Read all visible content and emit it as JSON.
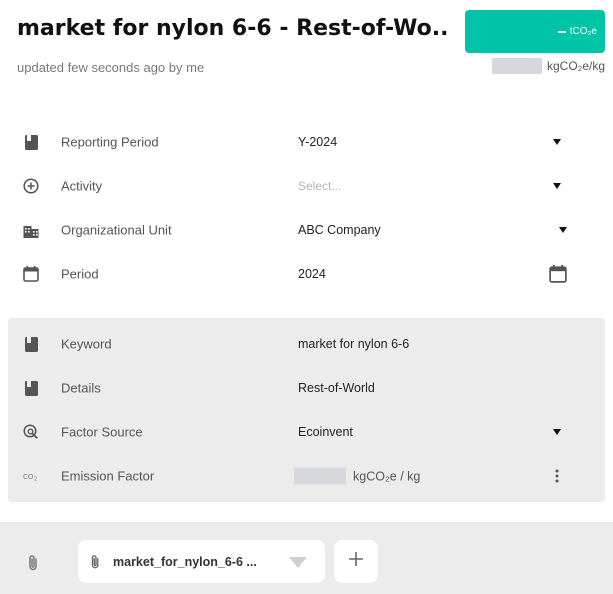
{
  "header": {
    "title": "market for nylon 6-6 - Rest-of-Wo...",
    "subtitle": "updated few seconds ago by me",
    "emission_unit": "tCO₂e",
    "intensity_unit": "kgCO₂e/kg",
    "accent_color": "#00c4a7"
  },
  "form": {
    "reporting_period": {
      "label": "Reporting Period",
      "value": "Y-2024",
      "icon": "bookmark-icon"
    },
    "activity": {
      "label": "Activity",
      "placeholder": "Select...",
      "icon": "add-circle-icon"
    },
    "organizational_unit": {
      "label": "Organizational Unit",
      "value": "ABC Company",
      "icon": "building-icon"
    },
    "period": {
      "label": "Period",
      "value": "2024",
      "icon": "calendar-icon"
    }
  },
  "details": {
    "keyword": {
      "label": "Keyword",
      "value": "market for nylon 6-6",
      "icon": "bookmark-icon"
    },
    "details": {
      "label": "Details",
      "value": "Rest-of-World",
      "icon": "bookmark-icon"
    },
    "factor_source": {
      "label": "Factor Source",
      "value": "Ecoinvent",
      "icon": "search-doc-icon"
    },
    "emission_factor": {
      "label": "Emission Factor",
      "unit": "kgCO₂e / kg",
      "icon": "co2-icon"
    }
  },
  "attachments": {
    "file_name": "market_for_nylon_6-6 ..."
  }
}
